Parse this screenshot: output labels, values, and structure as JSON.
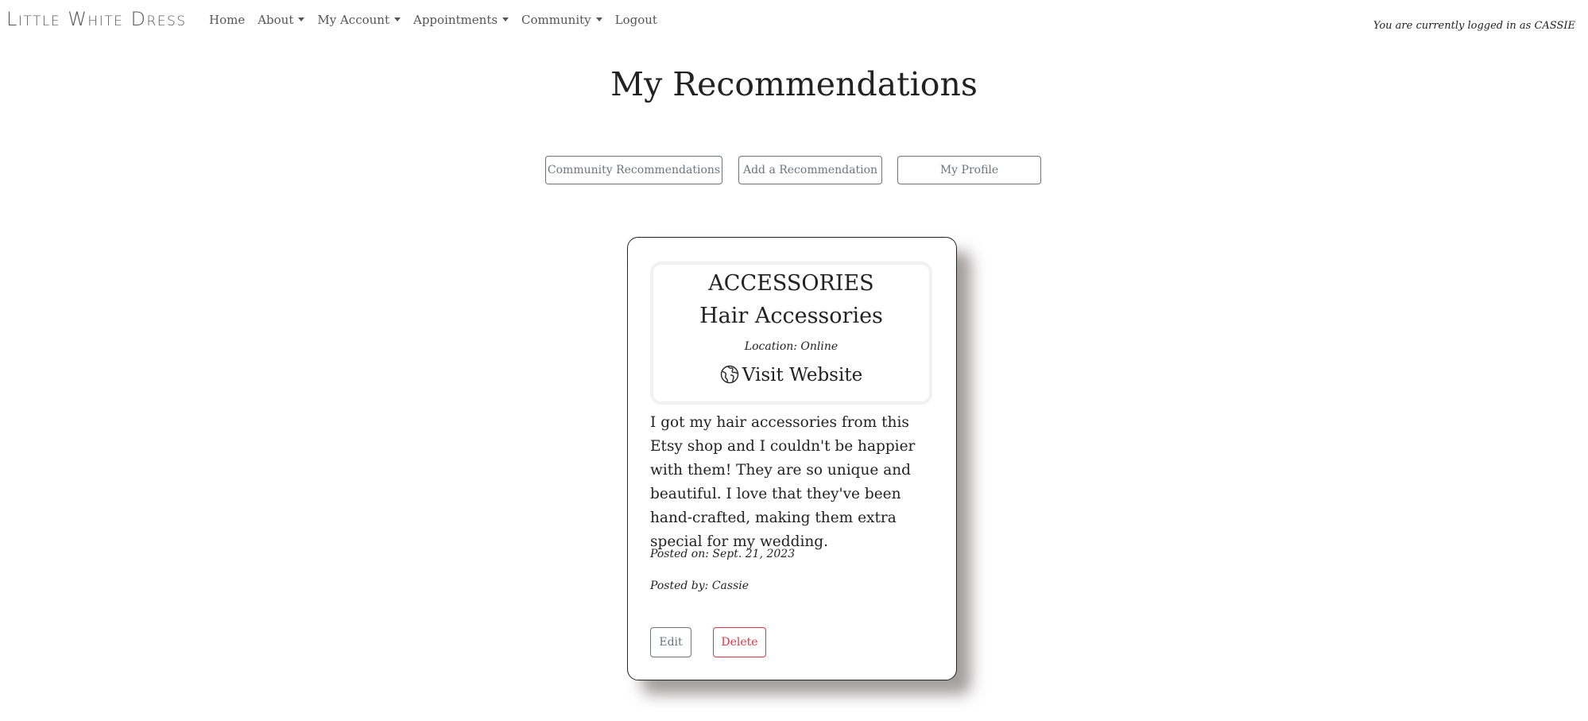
{
  "navbar": {
    "brand": "Little White Dress",
    "links": {
      "home": "Home",
      "about": "About",
      "my_account": "My Account",
      "appointments": "Appointments",
      "community": "Community",
      "logout": "Logout"
    },
    "login_status": "You are currently logged in as CASSIE"
  },
  "page": {
    "title": "My Recommendations"
  },
  "actions": {
    "community_recommendations": "Community Recommendations",
    "add_recommendation": "Add a Recommendation",
    "my_profile": "My Profile"
  },
  "recommendation": {
    "category": "ACCESSORIES",
    "subcategory": "Hair Accessories",
    "location": "Location: Online",
    "visit_website": "Visit Website",
    "description": "I got my hair accessories from this Etsy shop and I couldn't be happier with them! They are so unique and beautiful. I love that they've been hand-crafted, making them extra special for my wedding.",
    "posted_on": "Posted on: Sept. 21, 2023",
    "posted_by": "Posted by: Cassie",
    "edit_label": "Edit",
    "delete_label": "Delete"
  },
  "colors": {
    "secondary": "#6c757d",
    "danger": "#dc3545",
    "text": "#222222"
  },
  "icons": {
    "visit_website": "globe-icon",
    "dropdown": "caret-down-icon"
  }
}
